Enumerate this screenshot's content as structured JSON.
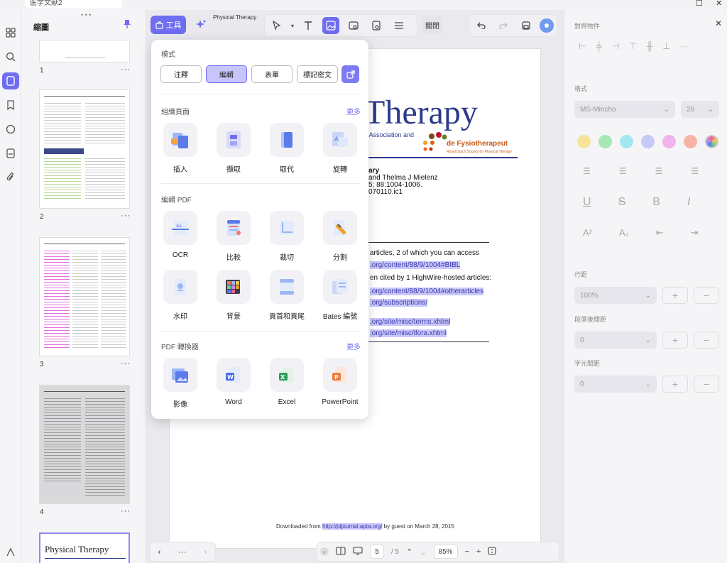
{
  "window": {
    "tab_title": "医学文献2",
    "doc_title": "Physical Therapy",
    "close_label": "關閉"
  },
  "thumbnails": {
    "title": "縮圖",
    "pages": [
      {
        "number": "1",
        "more": "···"
      },
      {
        "number": "2",
        "more": "···"
      },
      {
        "number": "3",
        "more": "···"
      },
      {
        "number": "4",
        "more": "···"
      }
    ],
    "page5_caption": "Physical Therapy"
  },
  "toolbar": {
    "tools_label": "工具"
  },
  "dropdown": {
    "mode_heading": "模式",
    "modes": [
      "注釋",
      "編輯",
      "表單",
      "標記密文"
    ],
    "active_mode": "編輯",
    "organize_heading": "組織頁面",
    "organize_more": "更多",
    "organize_tools": [
      "插入",
      "擷取",
      "取代",
      "旋轉"
    ],
    "edit_heading": "編輯 PDF",
    "edit_tools_row1": [
      "OCR",
      "比較",
      "裁切",
      "分割"
    ],
    "edit_tools_row2": [
      "水印",
      "背景",
      "頁首和頁尾",
      "Bates 編號"
    ],
    "convert_heading": "PDF 轉換器",
    "convert_more": "更多",
    "convert_tools": [
      "影像",
      "Word",
      "Excel",
      "PowerPoint"
    ]
  },
  "document": {
    "logo_text": "Therapy",
    "logo_sub": "y Association and",
    "logo_brand": "de Fysiotherapeut",
    "logo_tagline": "Royal Dutch Society for Physical Therapy",
    "line1": "ary",
    "line2": "and Thelma J Mielenz",
    "line3": "5; 88:1004-1006.",
    "line4": "070110.ic1",
    "line5": "articles, 2 of which you can access",
    "link1": ".org/content/88/9/1004#BIBL",
    "line6": "en cited by 1 HighWire-hosted articles:",
    "link2": ".org/content/88/9/1004#otherarticles",
    "link3": ".org/subscriptions/",
    "link4": ".org/site/misc/terms.xhtml",
    "link5": ".org/site/misc/ifora.xhtml",
    "footer_prefix": "Downloaded from",
    "footer_link": "http://ptjournal.apta.org/",
    "footer_suffix": "by guest on March 28, 2015"
  },
  "bottombar": {
    "more": "···",
    "page_current": "5",
    "page_total": "/ 5",
    "zoom": "85%"
  },
  "props": {
    "align_heading": "對齊物件",
    "format_heading": "格式",
    "font_value": "MS-Mincho",
    "size_value": "26",
    "line_spacing_label": "行距",
    "line_spacing_value": "100%",
    "paragraph_label": "段落後間距",
    "paragraph_value": "0",
    "char_label": "字元間距",
    "char_value": "0"
  }
}
